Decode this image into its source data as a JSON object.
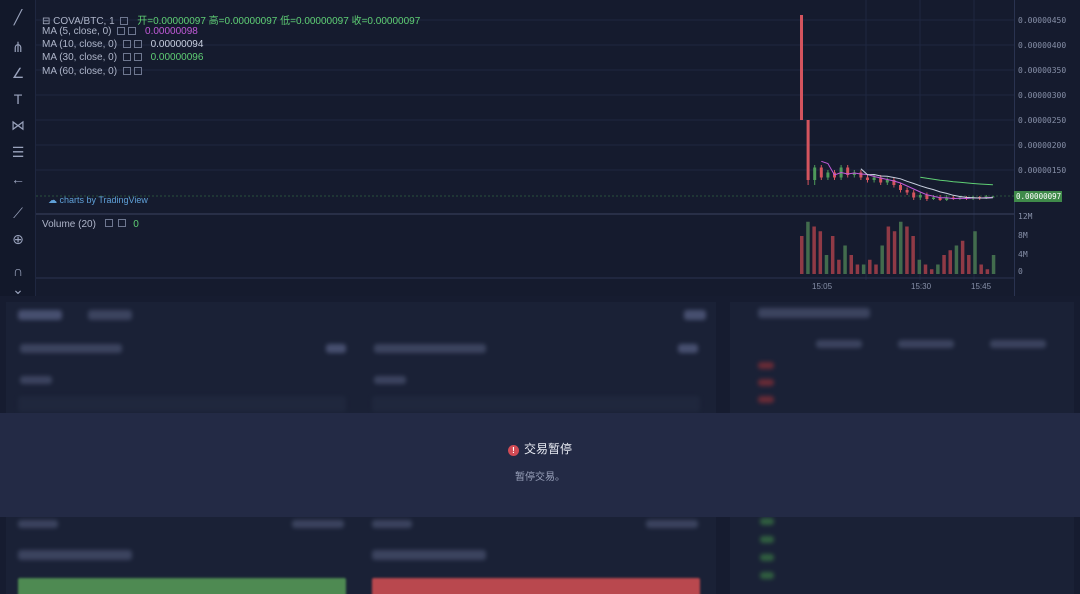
{
  "legend": {
    "symbol": "COVA/BTC, 1",
    "ohlc": "开=0.00000097  高=0.00000097  低=0.00000097  收=0.00000097",
    "ma5": {
      "label": "MA (5, close, 0)",
      "value": "0.00000098",
      "color": "#c15ad8"
    },
    "ma10": {
      "label": "MA (10, close, 0)",
      "value": "0.00000094",
      "color": "#c9d0e0"
    },
    "ma30": {
      "label": "MA (30, close, 0)",
      "value": "0.00000096",
      "color": "#5fcf74"
    },
    "ma60": {
      "label": "MA (60, close, 0)",
      "value": ""
    }
  },
  "price_axis": [
    "0.00000450",
    "0.00000400",
    "0.00000350",
    "0.00000300",
    "0.00000250",
    "0.00000200",
    "0.00000150"
  ],
  "last_price": "0.00000097",
  "credit": "charts by TradingView",
  "volume": {
    "label": "Volume (20)",
    "value": "0",
    "axis": [
      "12M",
      "8M",
      "4M",
      "0"
    ]
  },
  "time_axis": [
    "15:05",
    "15:30",
    "15:45"
  ],
  "colors": {
    "up": "#4e9a5a",
    "down": "#d4545e"
  },
  "chart_data": {
    "type": "candlestick",
    "price_range": [
      7e-07,
      4.7e-06
    ],
    "candles": [
      {
        "o": 4.6,
        "c": 2.5,
        "h": 4.6,
        "l": 2.5
      },
      {
        "o": 2.5,
        "c": 1.3,
        "h": 2.5,
        "l": 1.2
      },
      {
        "o": 1.3,
        "c": 1.55,
        "h": 1.6,
        "l": 1.2
      },
      {
        "o": 1.55,
        "c": 1.35,
        "h": 1.6,
        "l": 1.3
      },
      {
        "o": 1.35,
        "c": 1.45,
        "h": 1.5,
        "l": 1.3
      },
      {
        "o": 1.45,
        "c": 1.35,
        "h": 1.5,
        "l": 1.3
      },
      {
        "o": 1.35,
        "c": 1.55,
        "h": 1.6,
        "l": 1.3
      },
      {
        "o": 1.55,
        "c": 1.4,
        "h": 1.6,
        "l": 1.35
      },
      {
        "o": 1.4,
        "c": 1.45,
        "h": 1.5,
        "l": 1.35
      },
      {
        "o": 1.45,
        "c": 1.35,
        "h": 1.5,
        "l": 1.3
      },
      {
        "o": 1.35,
        "c": 1.3,
        "h": 1.4,
        "l": 1.25
      },
      {
        "o": 1.3,
        "c": 1.35,
        "h": 1.4,
        "l": 1.25
      },
      {
        "o": 1.35,
        "c": 1.25,
        "h": 1.4,
        "l": 1.2
      },
      {
        "o": 1.25,
        "c": 1.3,
        "h": 1.35,
        "l": 1.2
      },
      {
        "o": 1.3,
        "c": 1.2,
        "h": 1.35,
        "l": 1.15
      },
      {
        "o": 1.2,
        "c": 1.1,
        "h": 1.25,
        "l": 1.05
      },
      {
        "o": 1.1,
        "c": 1.05,
        "h": 1.15,
        "l": 1.0
      },
      {
        "o": 1.05,
        "c": 0.95,
        "h": 1.1,
        "l": 0.9
      },
      {
        "o": 0.95,
        "c": 1.0,
        "h": 1.05,
        "l": 0.9
      },
      {
        "o": 1.0,
        "c": 0.92,
        "h": 1.05,
        "l": 0.88
      },
      {
        "o": 0.92,
        "c": 0.95,
        "h": 1.0,
        "l": 0.9
      },
      {
        "o": 0.95,
        "c": 0.9,
        "h": 1.0,
        "l": 0.88
      },
      {
        "o": 0.9,
        "c": 0.95,
        "h": 1.0,
        "l": 0.88
      },
      {
        "o": 0.95,
        "c": 0.92,
        "h": 0.98,
        "l": 0.9
      },
      {
        "o": 0.92,
        "c": 0.95,
        "h": 0.98,
        "l": 0.9
      },
      {
        "o": 0.95,
        "c": 0.93,
        "h": 0.98,
        "l": 0.9
      },
      {
        "o": 0.93,
        "c": 0.96,
        "h": 0.98,
        "l": 0.9
      },
      {
        "o": 0.96,
        "c": 0.93,
        "h": 0.98,
        "l": 0.9
      },
      {
        "o": 0.93,
        "c": 0.97,
        "h": 1.0,
        "l": 0.92
      },
      {
        "o": 0.97,
        "c": 0.97,
        "h": 0.98,
        "l": 0.96
      }
    ],
    "volumes_m": [
      8,
      11,
      10,
      9,
      4,
      8,
      3,
      6,
      4,
      2,
      2,
      3,
      2,
      6,
      10,
      9,
      11,
      10,
      8,
      3,
      2,
      1,
      2,
      4,
      5,
      6,
      7,
      4,
      9,
      2,
      1,
      4
    ]
  }
}
